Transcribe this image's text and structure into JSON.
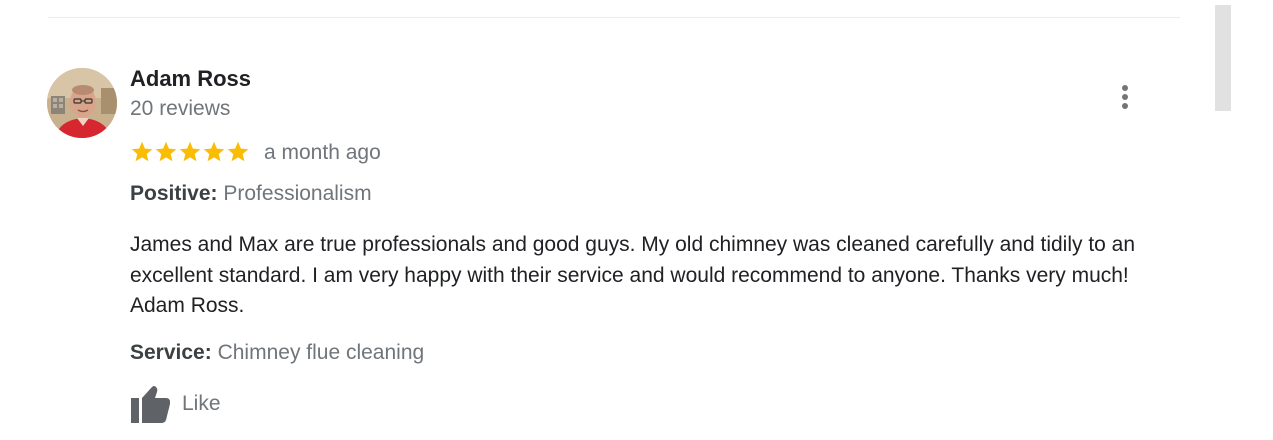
{
  "review": {
    "reviewer_name": "Adam Ross",
    "review_count": "20 reviews",
    "rating_stars": 5,
    "rating_max": 5,
    "star_color": "#fbbc04",
    "date": "a month ago",
    "positive_label": "Positive:",
    "positive_value": "Professionalism",
    "text": "James and Max are true professionals and good guys. My old chimney was cleaned carefully and tidily to an excellent standard. I am very happy with their service and would recommend to anyone. Thanks very much! Adam Ross.",
    "service_label": "Service:",
    "service_value": "Chimney flue cleaning",
    "like_label": "Like"
  },
  "icons": {
    "avatar": "avatar-photo",
    "more": "more-vert-icon",
    "star": "star-icon",
    "like": "thumbs-up-icon"
  }
}
